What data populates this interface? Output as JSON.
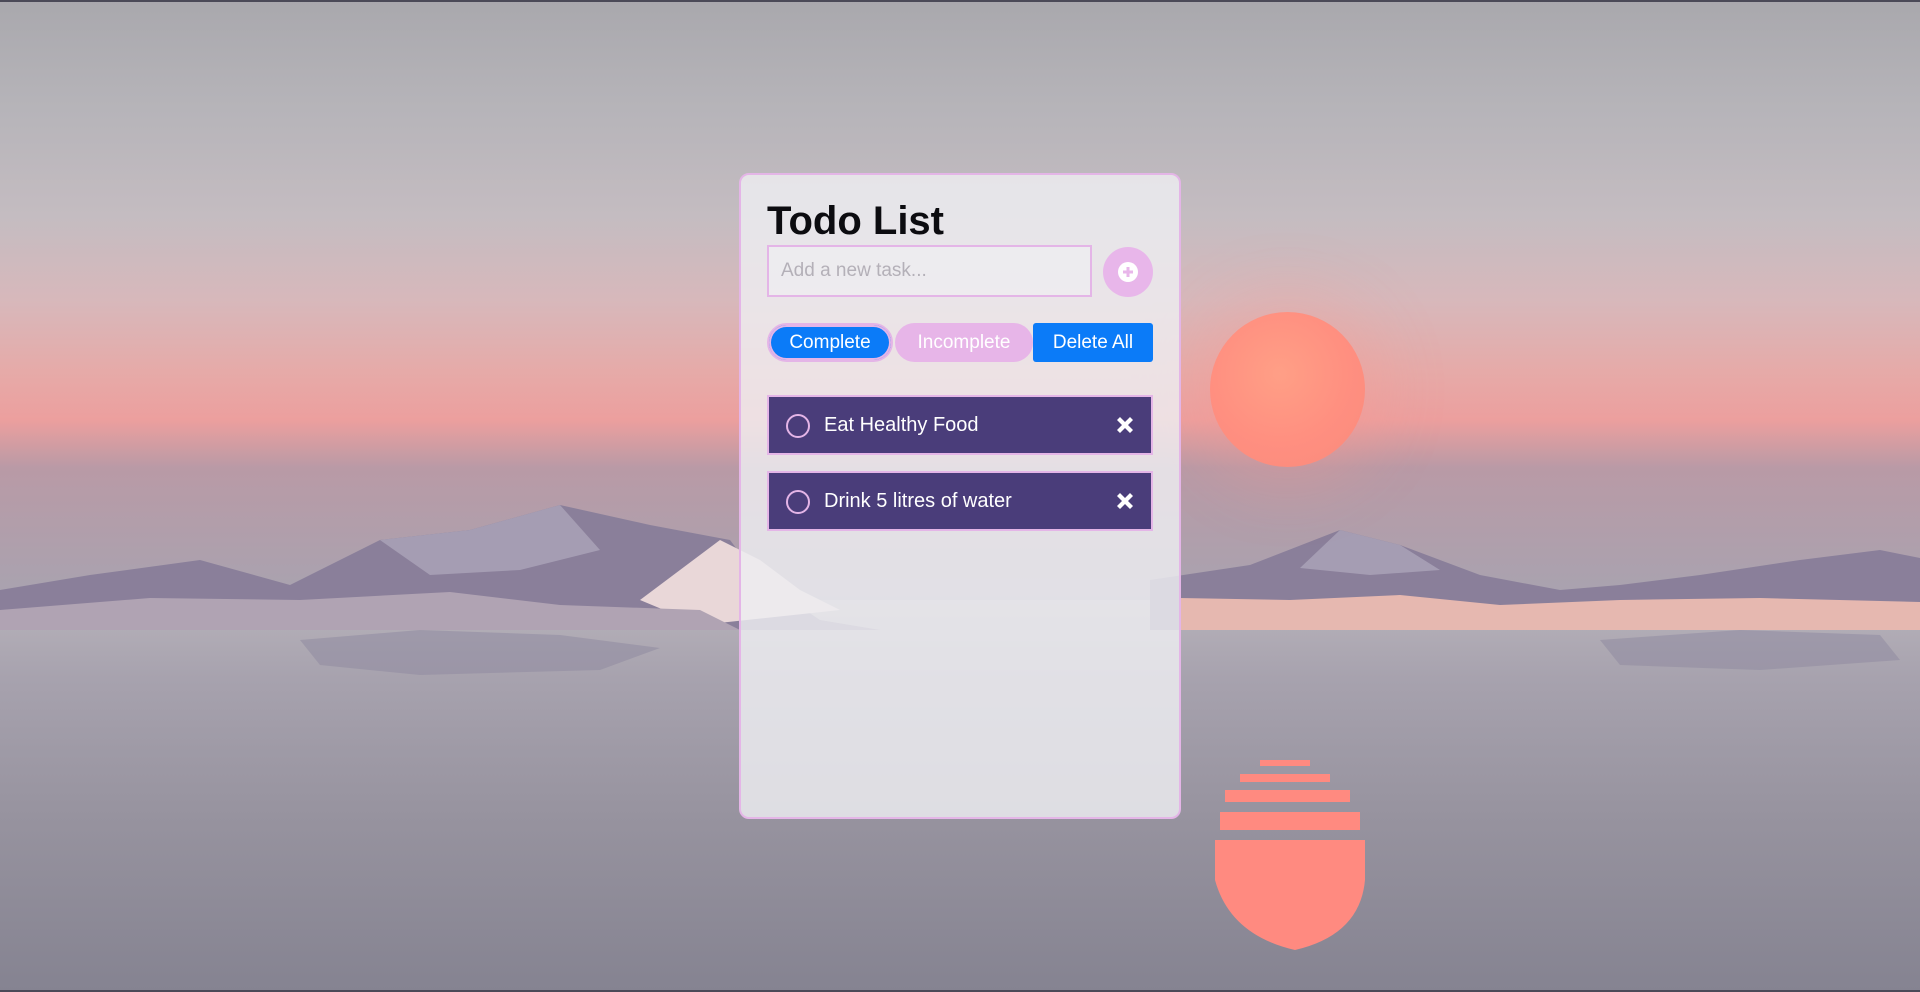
{
  "app": {
    "title": "Todo List"
  },
  "add_task": {
    "placeholder": "Add a new task...",
    "button_icon": "plus-circle-icon"
  },
  "filters": {
    "complete_label": "Complete",
    "incomplete_label": "Incomplete",
    "delete_all_label": "Delete All"
  },
  "tasks": [
    {
      "text": "Eat Healthy Food",
      "checkbox_icon": "circle-outline-icon",
      "delete_icon": "close-x-icon"
    },
    {
      "text": "Drink 5 litres of water",
      "checkbox_icon": "circle-outline-icon",
      "delete_icon": "close-x-icon"
    }
  ],
  "colors": {
    "accent_pink": "#e4b5e7",
    "button_blue": "#0b7bf8",
    "task_background": "#4a3d7a",
    "sun": "#ff8f80"
  }
}
